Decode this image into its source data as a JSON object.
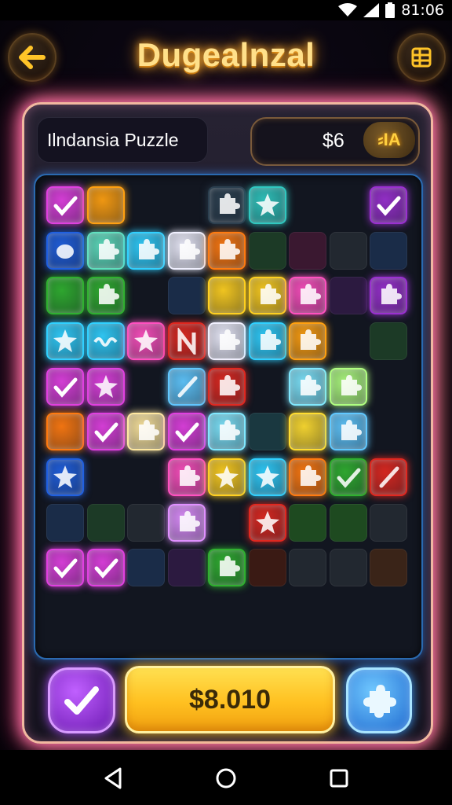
{
  "status_bar": {
    "time": "81:06"
  },
  "header": {
    "title": "Dugealnzal"
  },
  "panel": {
    "player_name": "Ilndansia Puzzle",
    "coin_value": "$6",
    "coin_badge": "⸗IA"
  },
  "actions": {
    "cash_label": "$8.010"
  },
  "board": {
    "rows": 9,
    "cols": 9,
    "tiles": [
      [
        "magenta-check",
        "amber-blank",
        "empty",
        "empty",
        "slate-piece",
        "teal-star",
        "empty",
        "empty",
        "purple-check"
      ],
      [
        "blue-blob",
        "mint-piece",
        "cyan-piece",
        "white-piece",
        "orange-piece",
        "dim-green",
        "dim-magenta",
        "dim-gray",
        "dim-blue"
      ],
      [
        "green-blank",
        "green-piece",
        "empty",
        "dim-blue",
        "gold-blank",
        "gold-piece",
        "pink-piece",
        "dim-purple",
        "purple-piece"
      ],
      [
        "cyan-star",
        "cyan-wave",
        "pink-star",
        "red-n",
        "white-piece",
        "cyan-piece",
        "amber-piece",
        "empty",
        "dim-green"
      ],
      [
        "magenta-check",
        "magenta-star",
        "empty",
        "sky-slash",
        "red-piece",
        "empty",
        "light-cyan-piece",
        "lime-piece",
        "empty"
      ],
      [
        "orange-blank",
        "magenta-check",
        "cream-piece",
        "magenta-check2",
        "light-cyan-piece",
        "dim-teal",
        "yellow-blank",
        "sky-piece",
        "empty"
      ],
      [
        "blue-star",
        "empty",
        "empty",
        "pink-piece",
        "gold-star",
        "cyan-star",
        "orange-piece",
        "green-check",
        "red-slash"
      ],
      [
        "dim-blue",
        "dim-green",
        "dim-gray",
        "lavender-piece",
        "empty",
        "red-star",
        "dim-green2",
        "dim-green2",
        "dim-gray"
      ],
      [
        "magenta-check",
        "magenta-check",
        "dim-blue",
        "dim-purple",
        "green-piece",
        "dim-red",
        "dim-gray",
        "dim-gray",
        "dim-brown"
      ]
    ]
  },
  "colors": {
    "accent_gold": "#ffc020",
    "panel_glow": "#ff7ab0",
    "board_border": "#2a6ab0"
  },
  "icons": {
    "back": "arrow-left-icon",
    "menu": "grid-menu-icon",
    "check": "checkmark-icon",
    "piece": "puzzle-piece-icon",
    "nav_back": "triangle-back-icon",
    "nav_home": "circle-home-icon",
    "nav_recent": "square-recent-icon"
  }
}
